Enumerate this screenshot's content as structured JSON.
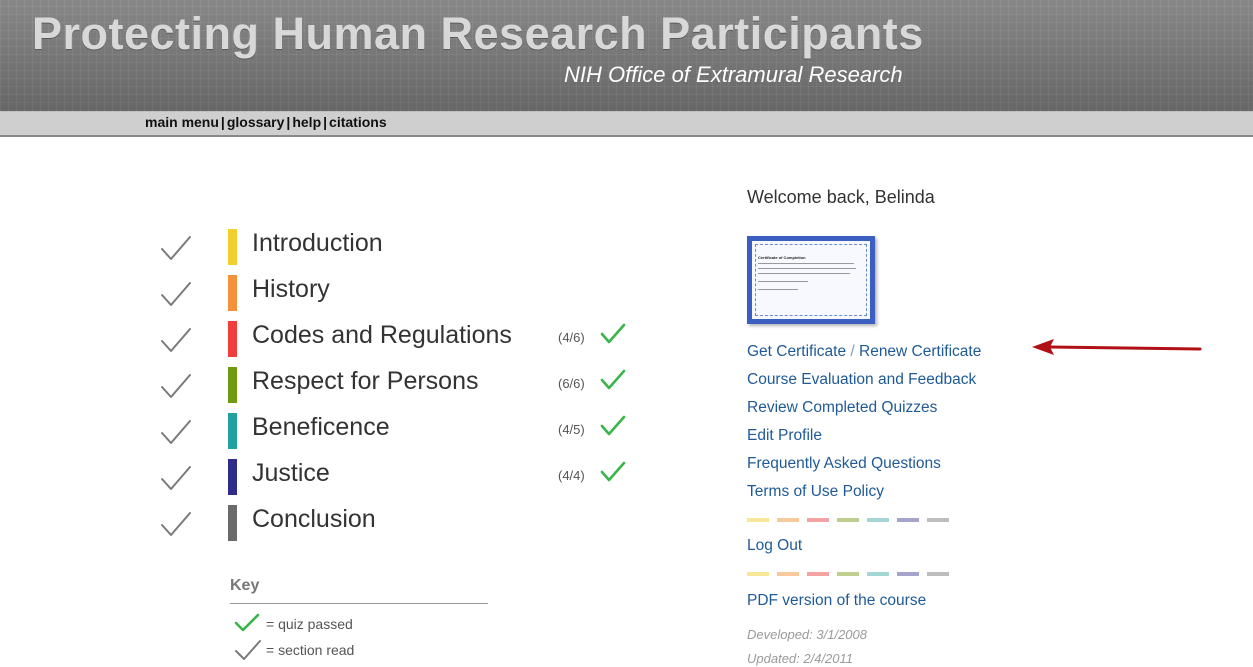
{
  "header": {
    "title": "Protecting Human Research Participants",
    "subtitle": "NIH Office of Extramural Research"
  },
  "nav": {
    "main_menu": "main menu",
    "glossary": "glossary",
    "help": "help",
    "citations": "citations",
    "separator": "|"
  },
  "sections": [
    {
      "label": "Introduction",
      "color": "#f2cf2c",
      "score": ""
    },
    {
      "label": "History",
      "color": "#f3923b",
      "score": ""
    },
    {
      "label": "Codes and Regulations",
      "color": "#ef3e3c",
      "score": "(4/6)"
    },
    {
      "label": "Respect for Persons",
      "color": "#6f9a0f",
      "score": "(6/6)"
    },
    {
      "label": "Beneficence",
      "color": "#20a09e",
      "score": "(4/5)"
    },
    {
      "label": "Justice",
      "color": "#2e2b8a",
      "score": "(4/4)"
    },
    {
      "label": "Conclusion",
      "color": "#6a6a6a",
      "score": ""
    }
  ],
  "key": {
    "title": "Key",
    "quiz_passed": "= quiz passed",
    "section_read": "= section read"
  },
  "sidebar": {
    "welcome": "Welcome back, Belinda",
    "certificate_title": "Certificate of Completion",
    "get_certificate": "Get Certificate",
    "link_separator": "/",
    "renew_certificate": "Renew Certificate",
    "course_evaluation": "Course Evaluation and Feedback",
    "review_quizzes": "Review Completed Quizzes",
    "edit_profile": "Edit Profile",
    "faq": "Frequently Asked Questions",
    "terms": "Terms of Use Policy",
    "log_out": "Log Out",
    "pdf_version": "PDF version of the course",
    "developed": "Developed: 3/1/2008",
    "updated": "Updated: 2/4/2011"
  },
  "colors": {
    "link": "#1f5a96",
    "check_gray": "#7a7a7a",
    "check_green": "#39b54a",
    "arrow_red": "#b01116",
    "strip": [
      "#f6e79a",
      "#f8c99d",
      "#f5a3a2",
      "#bfd08e",
      "#a4d6d5",
      "#a5a4cc",
      "#bdbdbd"
    ]
  }
}
